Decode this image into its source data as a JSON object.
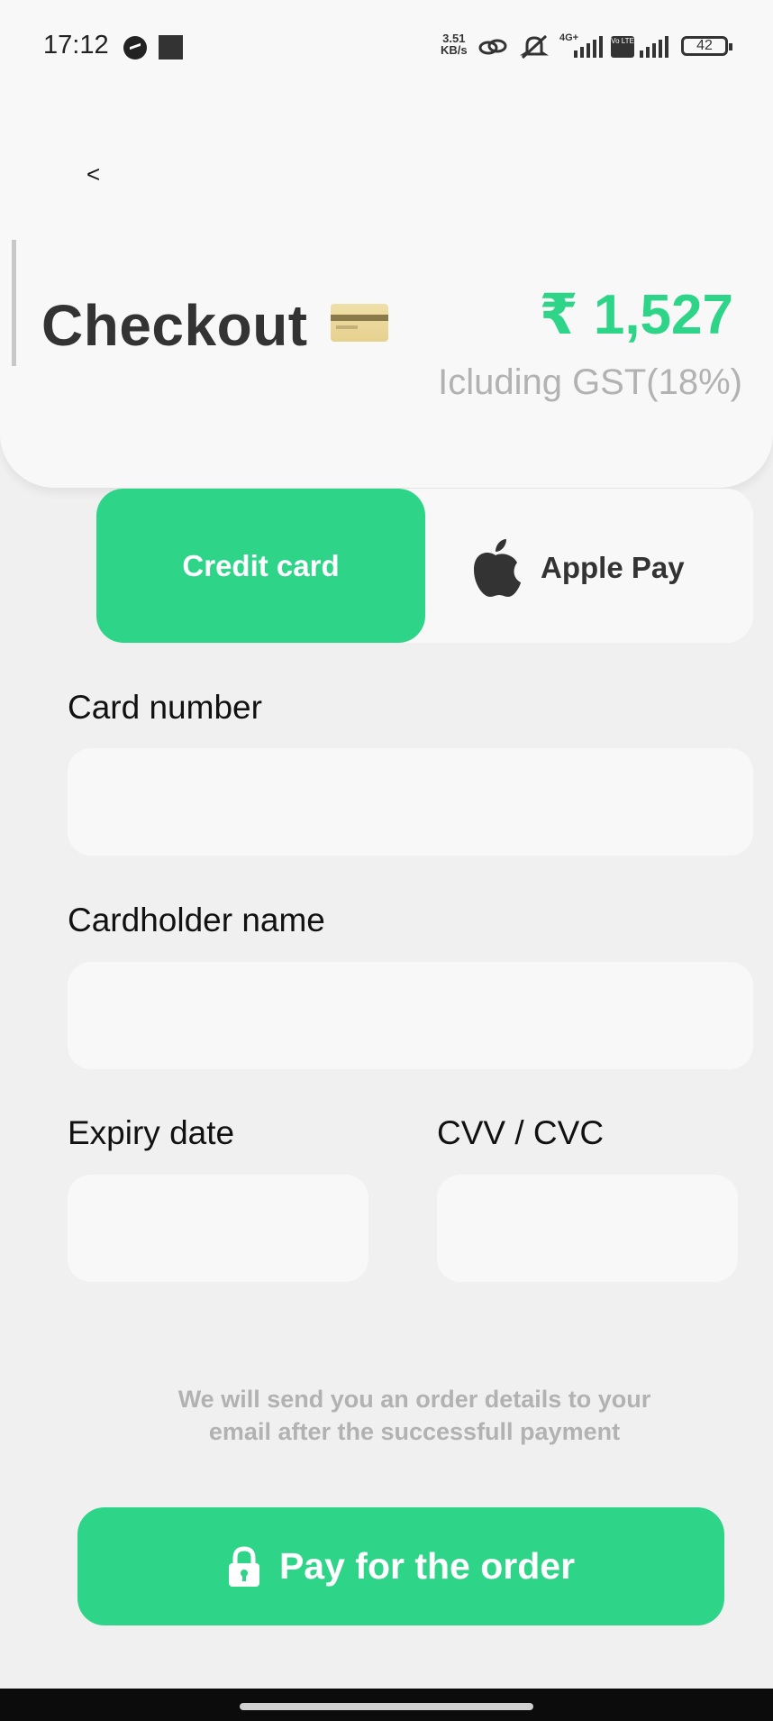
{
  "status_bar": {
    "time": "17:12",
    "net_speed_value": "3.51",
    "net_speed_unit": "KB/s",
    "network_label": "4G+",
    "volte_label": "Vo LTE",
    "battery": "42"
  },
  "header": {
    "back_label": "<",
    "title": "Checkout",
    "price": "₹ 1,527",
    "tax_note": "Icluding GST(18%)"
  },
  "payment_methods": {
    "credit_card_label": "Credit card",
    "apple_pay_label": "Apple Pay",
    "selected": "Credit card"
  },
  "form": {
    "card_number_label": "Card number",
    "card_number_value": "",
    "cardholder_name_label": "Cardholder name",
    "cardholder_name_value": "",
    "expiry_label": "Expiry date",
    "expiry_value": "",
    "cvv_label": "CVV / CVC",
    "cvv_value": ""
  },
  "info": {
    "line1": "We will send you an order details to your",
    "line2": "email after the successfull payment"
  },
  "pay_button_label": "Pay for the order",
  "colors": {
    "accent": "#2ed488",
    "background": "#f0f0f0",
    "card": "#f8f8f8",
    "muted_text": "#b2b2b2"
  },
  "icons": [
    "messenger-icon",
    "stop-icon",
    "link-icon",
    "mute-icon",
    "signal-icon",
    "battery-icon",
    "credit-card-icon",
    "apple-icon",
    "lock-icon"
  ]
}
